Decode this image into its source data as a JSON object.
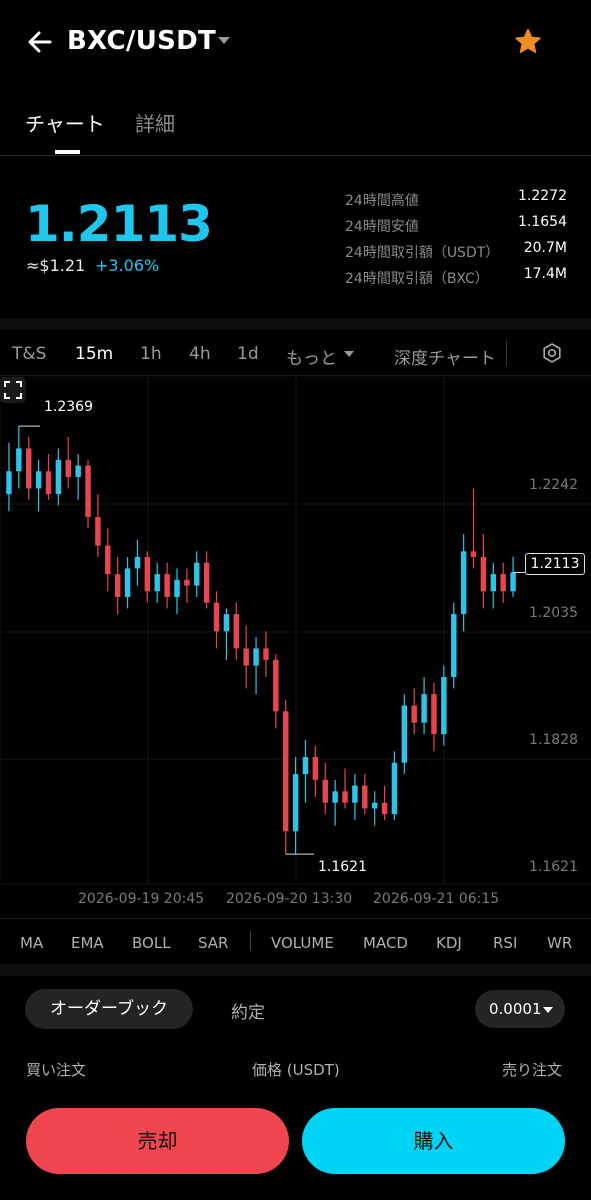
{
  "header": {
    "pair": "BXC/USDT",
    "icons": {
      "back": "arrow-left-icon",
      "caret": "caret-down-icon",
      "favorite": "star-icon"
    },
    "favorite_color": "#f08a24"
  },
  "tabs": {
    "chart": "チャート",
    "details": "詳細"
  },
  "ticker": {
    "price": "1.2113",
    "approx": "≈$1.21",
    "change": "+3.06%",
    "price_color": "#1fc7ee",
    "stats": [
      {
        "label": "24時間高値",
        "value": "1.2272"
      },
      {
        "label": "24時間安値",
        "value": "1.1654"
      },
      {
        "label": "24時間取引額（USDT）",
        "value": "20.7M"
      },
      {
        "label": "24時間取引額（BXC）",
        "value": "17.4M"
      }
    ]
  },
  "timeframes": {
    "items": [
      "T&S",
      "15m",
      "1h",
      "4h",
      "1d",
      "もっと"
    ],
    "active": "15m",
    "depth": "深度チャート",
    "settings_icon": "hexagon-gear-icon"
  },
  "chart": {
    "current_price_tag": "1.2113",
    "high_label": "1.2369",
    "low_label": "1.1621",
    "y_ticks": [
      "1.2242",
      "1.2035",
      "1.1828",
      "1.1621"
    ],
    "x_ticks": [
      "2026-09-19 20:45",
      "2026-09-20 13:30",
      "2026-09-21 06:15"
    ],
    "up_color": "#2ec4e8",
    "down_color": "#e8464e",
    "expand_icon": "fullscreen-icon"
  },
  "chart_data": {
    "type": "candlestick",
    "ylim": [
      1.158,
      1.242
    ],
    "series": [
      {
        "o": 1.225,
        "h": 1.234,
        "l": 1.222,
        "c": 1.229
      },
      {
        "o": 1.229,
        "h": 1.2369,
        "l": 1.226,
        "c": 1.233
      },
      {
        "o": 1.233,
        "h": 1.235,
        "l": 1.224,
        "c": 1.226
      },
      {
        "o": 1.226,
        "h": 1.231,
        "l": 1.222,
        "c": 1.229
      },
      {
        "o": 1.229,
        "h": 1.232,
        "l": 1.224,
        "c": 1.225
      },
      {
        "o": 1.225,
        "h": 1.233,
        "l": 1.223,
        "c": 1.231
      },
      {
        "o": 1.231,
        "h": 1.235,
        "l": 1.226,
        "c": 1.228
      },
      {
        "o": 1.228,
        "h": 1.232,
        "l": 1.224,
        "c": 1.23
      },
      {
        "o": 1.23,
        "h": 1.231,
        "l": 1.219,
        "c": 1.221
      },
      {
        "o": 1.221,
        "h": 1.225,
        "l": 1.214,
        "c": 1.216
      },
      {
        "o": 1.216,
        "h": 1.219,
        "l": 1.208,
        "c": 1.211
      },
      {
        "o": 1.211,
        "h": 1.214,
        "l": 1.204,
        "c": 1.207
      },
      {
        "o": 1.207,
        "h": 1.214,
        "l": 1.205,
        "c": 1.212
      },
      {
        "o": 1.212,
        "h": 1.217,
        "l": 1.209,
        "c": 1.214
      },
      {
        "o": 1.214,
        "h": 1.215,
        "l": 1.206,
        "c": 1.208
      },
      {
        "o": 1.208,
        "h": 1.213,
        "l": 1.206,
        "c": 1.211
      },
      {
        "o": 1.211,
        "h": 1.213,
        "l": 1.205,
        "c": 1.207
      },
      {
        "o": 1.207,
        "h": 1.212,
        "l": 1.204,
        "c": 1.21
      },
      {
        "o": 1.21,
        "h": 1.212,
        "l": 1.206,
        "c": 1.209
      },
      {
        "o": 1.209,
        "h": 1.215,
        "l": 1.207,
        "c": 1.213
      },
      {
        "o": 1.213,
        "h": 1.215,
        "l": 1.205,
        "c": 1.206
      },
      {
        "o": 1.206,
        "h": 1.208,
        "l": 1.198,
        "c": 1.201
      },
      {
        "o": 1.201,
        "h": 1.205,
        "l": 1.196,
        "c": 1.204
      },
      {
        "o": 1.204,
        "h": 1.206,
        "l": 1.196,
        "c": 1.198
      },
      {
        "o": 1.198,
        "h": 1.202,
        "l": 1.191,
        "c": 1.195
      },
      {
        "o": 1.195,
        "h": 1.2,
        "l": 1.19,
        "c": 1.198
      },
      {
        "o": 1.198,
        "h": 1.201,
        "l": 1.193,
        "c": 1.196
      },
      {
        "o": 1.196,
        "h": 1.197,
        "l": 1.184,
        "c": 1.187
      },
      {
        "o": 1.187,
        "h": 1.189,
        "l": 1.162,
        "c": 1.166
      },
      {
        "o": 1.166,
        "h": 1.179,
        "l": 1.1621,
        "c": 1.176
      },
      {
        "o": 1.176,
        "h": 1.182,
        "l": 1.171,
        "c": 1.179
      },
      {
        "o": 1.179,
        "h": 1.181,
        "l": 1.172,
        "c": 1.175
      },
      {
        "o": 1.175,
        "h": 1.178,
        "l": 1.169,
        "c": 1.171
      },
      {
        "o": 1.171,
        "h": 1.175,
        "l": 1.167,
        "c": 1.173
      },
      {
        "o": 1.173,
        "h": 1.177,
        "l": 1.17,
        "c": 1.171
      },
      {
        "o": 1.171,
        "h": 1.176,
        "l": 1.168,
        "c": 1.174
      },
      {
        "o": 1.174,
        "h": 1.176,
        "l": 1.169,
        "c": 1.17
      },
      {
        "o": 1.17,
        "h": 1.173,
        "l": 1.167,
        "c": 1.171
      },
      {
        "o": 1.171,
        "h": 1.174,
        "l": 1.168,
        "c": 1.169
      },
      {
        "o": 1.169,
        "h": 1.18,
        "l": 1.168,
        "c": 1.178
      },
      {
        "o": 1.178,
        "h": 1.19,
        "l": 1.176,
        "c": 1.188
      },
      {
        "o": 1.188,
        "h": 1.191,
        "l": 1.183,
        "c": 1.185
      },
      {
        "o": 1.185,
        "h": 1.193,
        "l": 1.183,
        "c": 1.19
      },
      {
        "o": 1.19,
        "h": 1.192,
        "l": 1.18,
        "c": 1.183
      },
      {
        "o": 1.183,
        "h": 1.195,
        "l": 1.181,
        "c": 1.193
      },
      {
        "o": 1.193,
        "h": 1.206,
        "l": 1.191,
        "c": 1.204
      },
      {
        "o": 1.204,
        "h": 1.218,
        "l": 1.201,
        "c": 1.215
      },
      {
        "o": 1.215,
        "h": 1.226,
        "l": 1.212,
        "c": 1.214
      },
      {
        "o": 1.214,
        "h": 1.218,
        "l": 1.205,
        "c": 1.208
      },
      {
        "o": 1.208,
        "h": 1.213,
        "l": 1.205,
        "c": 1.211
      },
      {
        "o": 1.211,
        "h": 1.213,
        "l": 1.206,
        "c": 1.208
      },
      {
        "o": 1.208,
        "h": 1.214,
        "l": 1.207,
        "c": 1.2113
      }
    ]
  },
  "indicators": [
    "MA",
    "EMA",
    "BOLL",
    "SAR",
    "VOLUME",
    "MACD",
    "KDJ",
    "RSI",
    "WR"
  ],
  "orderbook": {
    "tabs": [
      "オーダーブック",
      "約定"
    ],
    "precision": "0.0001",
    "columns": {
      "bids": "買い注文",
      "price": "価格 (USDT)",
      "asks": "売り注文"
    }
  },
  "actions": {
    "sell": "売却",
    "buy": "購入",
    "sell_color": "#f04650",
    "buy_color": "#00d4f5"
  }
}
